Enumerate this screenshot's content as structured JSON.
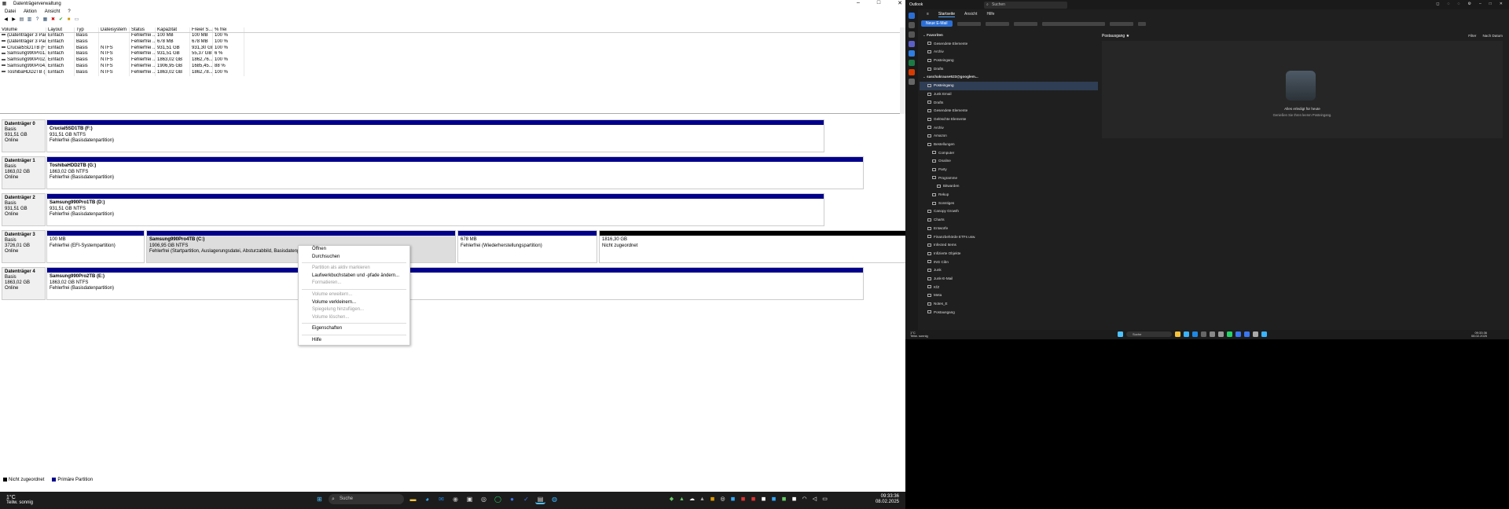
{
  "dm": {
    "window_title": "Datenträgerverwaltung",
    "win_controls": [
      "–",
      "□",
      "✕"
    ],
    "menus": [
      "Datei",
      "Aktion",
      "Ansicht",
      "?"
    ],
    "columns": [
      "Volume",
      "Layout",
      "Typ",
      "Dateisystem",
      "Status",
      "Kapazität",
      "Freier S...",
      "% frei"
    ],
    "volumes": [
      [
        "(Datenträger 3 Par...",
        "Einfach",
        "Basis",
        "",
        "Fehlerfrei ...",
        "100 MB",
        "100 MB",
        "100 %"
      ],
      [
        "(Datenträger 3 Par...",
        "Einfach",
        "Basis",
        "",
        "Fehlerfrei ...",
        "678 MB",
        "678 MB",
        "100 %"
      ],
      [
        "Crucial5SD1TB (F:)",
        "Einfach",
        "Basis",
        "NTFS",
        "Fehlerfrei ...",
        "931,51 GB",
        "931,30 GB",
        "100 %"
      ],
      [
        "Samsung990Pro1...",
        "Einfach",
        "Basis",
        "NTFS",
        "Fehlerfrei ...",
        "931,51 GB",
        "55,37 GB",
        "6 %"
      ],
      [
        "Samsung990Pro2...",
        "Einfach",
        "Basis",
        "NTFS",
        "Fehlerfrei ...",
        "1863,02 GB",
        "1862,76...",
        "100 %"
      ],
      [
        "Samsung990Pro4...",
        "Einfach",
        "Basis",
        "NTFS",
        "Fehlerfrei ...",
        "1906,95 GB",
        "1685,45...",
        "88 %"
      ],
      [
        "ToshibaHDD2TB (...",
        "Einfach",
        "Basis",
        "NTFS",
        "Fehlerfrei ...",
        "1863,02 GB",
        "1862,78...",
        "100 %"
      ]
    ],
    "disks": [
      {
        "name": "Datenträger 0",
        "type": "Basis",
        "size": "931,51 GB",
        "state": "Online",
        "parts": [
          {
            "title": "Crucial5SD1TB  (F:)",
            "l1": "931,51 GB NTFS",
            "l2": "Fehlerfrei (Basisdatenpartition)"
          }
        ]
      },
      {
        "name": "Datenträger 1",
        "type": "Basis",
        "size": "1863,02 GB",
        "state": "Online",
        "parts": [
          {
            "title": "ToshibaHDD2TB  (G:)",
            "l1": "1863,02 GB NTFS",
            "l2": "Fehlerfrei (Basisdatenpartition)"
          }
        ]
      },
      {
        "name": "Datenträger 2",
        "type": "Basis",
        "size": "931,51 GB",
        "state": "Online",
        "parts": [
          {
            "title": "Samsung990Pro1TB  (D:)",
            "l1": "931,51 GB NTFS",
            "l2": "Fehlerfrei (Basisdatenpartition)"
          }
        ]
      },
      {
        "name": "Datenträger 3",
        "type": "Basis",
        "size": "3726,01 GB",
        "state": "Online",
        "parts": [
          {
            "title": "",
            "l1": "100 MB",
            "l2": "Fehlerfrei (EFI-Systempartition)"
          },
          {
            "title": "Samsung990Pro4TB  (C:)",
            "l1": "1906,95 GB NTFS",
            "l2": "Fehlerfrei (Startpartition, Auslagerungsdatei, Absturzabbild, Basisdatenpartition)"
          },
          {
            "title": "",
            "l1": "678 MB",
            "l2": "Fehlerfrei (Wiederherstellungspartition)"
          },
          {
            "title": "",
            "l1": "1816,30 GB",
            "l2": "Nicht zugeordnet"
          }
        ]
      },
      {
        "name": "Datenträger 4",
        "type": "Basis",
        "size": "1863,02 GB",
        "state": "Online",
        "parts": [
          {
            "title": "Samsung990Pro2TB  (E:)",
            "l1": "1863,02 GB NTFS",
            "l2": "Fehlerfrei (Basisdatenpartition)"
          }
        ]
      }
    ],
    "legend": [
      "Nicht zugeordnet",
      "Primäre Partition"
    ],
    "context_menu": [
      {
        "label": "Öffnen",
        "enabled": true
      },
      {
        "label": "Durchsuchen",
        "enabled": true
      },
      {
        "sep": true
      },
      {
        "label": "Partition als aktiv markieren",
        "enabled": false
      },
      {
        "label": "Laufwerkbuchstaben und -pfade ändern...",
        "enabled": true
      },
      {
        "label": "Formatieren...",
        "enabled": false
      },
      {
        "sep": true
      },
      {
        "label": "Volume erweitern...",
        "enabled": false
      },
      {
        "label": "Volume verkleinern...",
        "enabled": true
      },
      {
        "label": "Spiegelung hinzufügen...",
        "enabled": false
      },
      {
        "label": "Volume löschen...",
        "enabled": false
      },
      {
        "sep": true
      },
      {
        "label": "Eigenschaften",
        "enabled": true
      },
      {
        "sep": true
      },
      {
        "label": "Hilfe",
        "enabled": true
      }
    ]
  },
  "taskbar": {
    "temp": "1°C",
    "weather": "Teilw. sonnig",
    "search": "Suche",
    "time": "09:33:36",
    "date": "08.02.2025"
  },
  "outlook": {
    "app": "Outlook",
    "search": "Suchen",
    "tabs": [
      "Startseite",
      "Ansicht",
      "Hilfe"
    ],
    "new_mail": "Neue E-Mail",
    "folder_header": "Postausgang",
    "filter": "Filter",
    "sort": "Nach Datum",
    "empty_title": "Alles erledigt für heute",
    "empty_sub": "Genießen Sie Ihren leeren Posteingang.",
    "folders": [
      {
        "label": "Favoriten",
        "level": 0,
        "group": true
      },
      {
        "label": "Gesendete Elemente",
        "level": 1
      },
      {
        "label": "Archiv",
        "level": 1
      },
      {
        "label": "Posteingang",
        "level": 1
      },
      {
        "label": "Drafts",
        "level": 1
      },
      {
        "label": "saschakrause523@googlem...",
        "level": 0,
        "group": true
      },
      {
        "label": "Posteingang",
        "level": 1,
        "sel": true
      },
      {
        "label": "Junk Email",
        "level": 1
      },
      {
        "label": "Drafts",
        "level": 1
      },
      {
        "label": "Gesendete Elemente",
        "level": 1
      },
      {
        "label": "Gelöschte Elemente",
        "level": 1
      },
      {
        "label": "Archiv",
        "level": 1
      },
      {
        "label": "Amazon",
        "level": 1
      },
      {
        "label": "Bestellungen",
        "level": 1
      },
      {
        "label": "Computer",
        "level": 2
      },
      {
        "label": "Onaline",
        "level": 2
      },
      {
        "label": "Party",
        "level": 2
      },
      {
        "label": "Programme",
        "level": 2
      },
      {
        "label": "Bitwarden",
        "level": 3
      },
      {
        "label": "Rekup",
        "level": 2
      },
      {
        "label": "Sonstiges",
        "level": 2
      },
      {
        "label": "Canopy Growth",
        "level": 1
      },
      {
        "label": "Charts",
        "level": 1
      },
      {
        "label": "Entwürfe",
        "level": 1
      },
      {
        "label": "Finanzbehörde ETFs usw.",
        "level": 1
      },
      {
        "label": "Infected Items",
        "level": 1
      },
      {
        "label": "Infizierte Objekte",
        "level": 1
      },
      {
        "label": "ING Cibn",
        "level": 1
      },
      {
        "label": "Junk",
        "level": 1
      },
      {
        "label": "Junk-E-Mail",
        "level": 1
      },
      {
        "label": "KfZ",
        "level": 1
      },
      {
        "label": "Meta",
        "level": 1
      },
      {
        "label": "Notes_E",
        "level": 1
      },
      {
        "label": "Postausgang",
        "level": 1
      }
    ],
    "taskbar": {
      "temp": "1°C",
      "weather": "Teilw. sonnig",
      "search": "Suche",
      "time": "09:33:36",
      "date": "08.02.2025"
    }
  }
}
